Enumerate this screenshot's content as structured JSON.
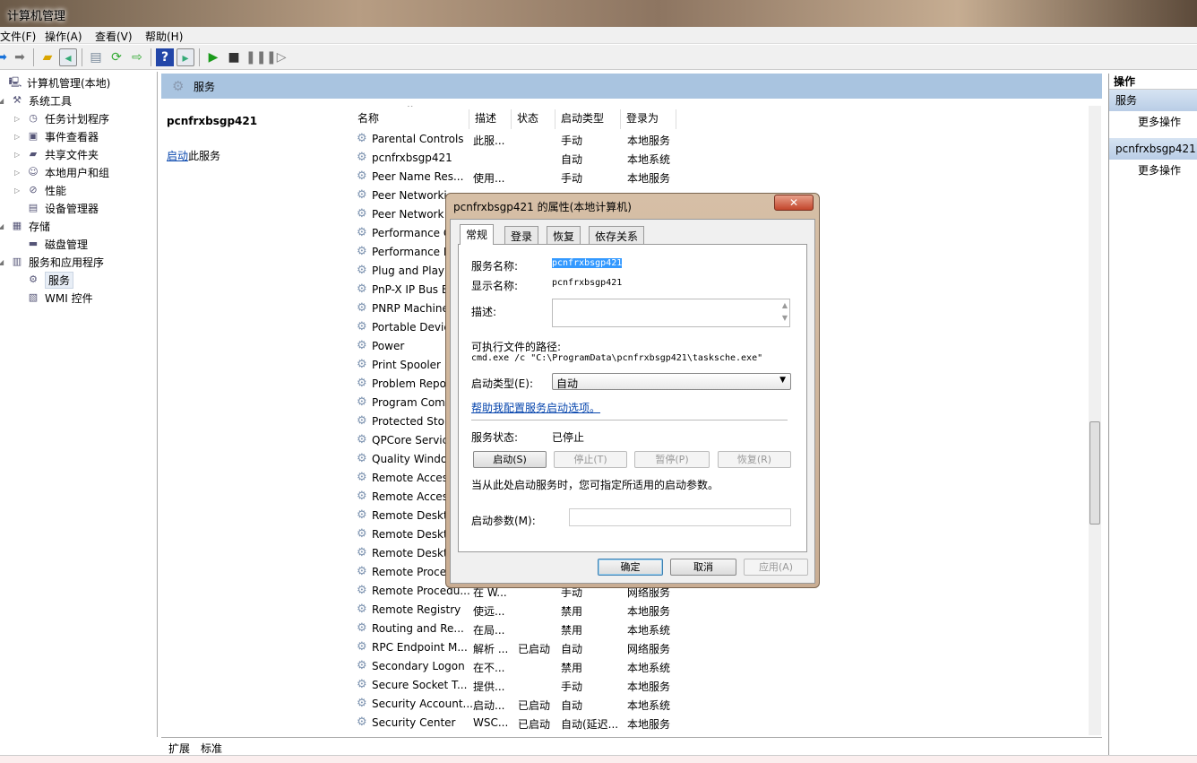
{
  "window": {
    "title": "计算机管理"
  },
  "menu": [
    "文件(F)",
    "操作(A)",
    "查看(V)",
    "帮助(H)"
  ],
  "toolbar": {
    "icons": [
      "back-icon",
      "forward-icon",
      "up-folder-icon",
      "show-hide-tree-icon",
      "properties-icon",
      "refresh-icon",
      "export-list-icon",
      "help-icon",
      "show-hide-action-pane-icon",
      "play-icon",
      "stop-icon",
      "pause-icon",
      "resume-icon"
    ]
  },
  "tree": [
    {
      "label": "计算机管理(本地)",
      "level": 0,
      "icon": "computer-icon"
    },
    {
      "label": "系统工具",
      "level": 1,
      "icon": "tools-icon"
    },
    {
      "label": "任务计划程序",
      "level": 2,
      "icon": "clock-icon"
    },
    {
      "label": "事件查看器",
      "level": 2,
      "icon": "event-viewer-icon"
    },
    {
      "label": "共享文件夹",
      "level": 2,
      "icon": "shared-folder-icon"
    },
    {
      "label": "本地用户和组",
      "level": 2,
      "icon": "users-icon"
    },
    {
      "label": "性能",
      "level": 2,
      "icon": "performance-icon"
    },
    {
      "label": "设备管理器",
      "level": 2,
      "icon": "device-manager-icon"
    },
    {
      "label": "存储",
      "level": 1,
      "icon": "storage-icon"
    },
    {
      "label": "磁盘管理",
      "level": 2,
      "icon": "disk-icon"
    },
    {
      "label": "服务和应用程序",
      "level": 1,
      "icon": "services-apps-icon"
    },
    {
      "label": "服务",
      "level": 2,
      "icon": "gear-icon",
      "selected": true
    },
    {
      "label": "WMI 控件",
      "level": 2,
      "icon": "wmi-icon"
    }
  ],
  "header": {
    "title": "服务"
  },
  "desc_panel": {
    "service": "pcnfrxbsgp421",
    "link": "启动",
    "link_suffix": "此服务"
  },
  "columns": [
    "名称",
    "描述",
    "状态",
    "启动类型",
    "登录为"
  ],
  "services": [
    [
      "Parental Controls",
      "此服...",
      "",
      "手动",
      "本地服务"
    ],
    [
      "pcnfrxbsgp421",
      "",
      "",
      "自动",
      "本地系统"
    ],
    [
      "Peer Name Res...",
      "使用...",
      "",
      "手动",
      "本地服务"
    ],
    [
      "Peer Networki",
      "",
      "",
      "",
      ""
    ],
    [
      "Peer Network",
      "",
      "",
      "",
      ""
    ],
    [
      "Performance C",
      "",
      "",
      "",
      ""
    ],
    [
      "Performance L",
      "",
      "",
      "",
      ""
    ],
    [
      "Plug and Play",
      "",
      "",
      "",
      ""
    ],
    [
      "PnP-X IP Bus E",
      "",
      "",
      "",
      ""
    ],
    [
      "PNRP Machine",
      "",
      "",
      "",
      ""
    ],
    [
      "Portable Devic",
      "",
      "",
      "",
      ""
    ],
    [
      "Power",
      "",
      "",
      "",
      ""
    ],
    [
      "Print Spooler",
      "",
      "",
      "",
      ""
    ],
    [
      "Problem Repo",
      "",
      "",
      "",
      ""
    ],
    [
      "Program Comp",
      "",
      "",
      "",
      ""
    ],
    [
      "Protected Stor",
      "",
      "",
      "",
      ""
    ],
    [
      "QPCore Servic",
      "",
      "",
      "",
      ""
    ],
    [
      "Quality Windo",
      "",
      "",
      "",
      ""
    ],
    [
      "Remote Acces",
      "",
      "",
      "",
      ""
    ],
    [
      "Remote Acces",
      "",
      "",
      "",
      ""
    ],
    [
      "Remote Deskt",
      "",
      "",
      "",
      ""
    ],
    [
      "Remote Deskt",
      "",
      "",
      "",
      ""
    ],
    [
      "Remote Deskt",
      "",
      "",
      "",
      ""
    ],
    [
      "Remote Proce",
      "",
      "",
      "",
      ""
    ],
    [
      "Remote Procedu...",
      "在 W...",
      "",
      "手动",
      "网络服务"
    ],
    [
      "Remote Registry",
      "使远...",
      "",
      "禁用",
      "本地服务"
    ],
    [
      "Routing and Re...",
      "在局...",
      "",
      "禁用",
      "本地系统"
    ],
    [
      "RPC Endpoint M...",
      "解析 ...",
      "已启动",
      "自动",
      "网络服务"
    ],
    [
      "Secondary Logon",
      "在不...",
      "",
      "禁用",
      "本地系统"
    ],
    [
      "Secure Socket T...",
      "提供...",
      "",
      "手动",
      "本地服务"
    ],
    [
      "Security Account...",
      "启动...",
      "已启动",
      "自动",
      "本地系统"
    ],
    [
      "Security Center",
      "WSC...",
      "已启动",
      "自动(延迟...",
      "本地服务"
    ]
  ],
  "bottom_tabs": [
    "扩展",
    "标准"
  ],
  "actions": {
    "title": "操作",
    "sections": [
      {
        "name": "服务",
        "item": "更多操作"
      },
      {
        "name": "pcnfrxbsgp421",
        "item": "更多操作"
      }
    ]
  },
  "dialog": {
    "title": "pcnfrxbsgp421 的属性(本地计算机)",
    "tabs": [
      "常规",
      "登录",
      "恢复",
      "依存关系"
    ],
    "service_name_label": "服务名称:",
    "service_name": "pcnfrxbsgp421",
    "display_name_label": "显示名称:",
    "display_name": "pcnfrxbsgp421",
    "description_label": "描述:",
    "description": "",
    "path_label": "可执行文件的路径:",
    "path": "cmd.exe /c \"C:\\ProgramData\\pcnfrxbsgp421\\tasksche.exe\"",
    "startup_type_label": "启动类型(E):",
    "startup_type": "自动",
    "help_link": "帮助我配置服务启动选项。",
    "status_label": "服务状态:",
    "status": "已停止",
    "buttons": {
      "start": "启动(S)",
      "stop": "停止(T)",
      "pause": "暂停(P)",
      "resume": "恢复(R)"
    },
    "params_note": "当从此处启动服务时，您可指定所适用的启动参数。",
    "params_label": "启动参数(M):",
    "params": "",
    "ok": "确定",
    "cancel": "取消",
    "apply": "应用(A)"
  }
}
